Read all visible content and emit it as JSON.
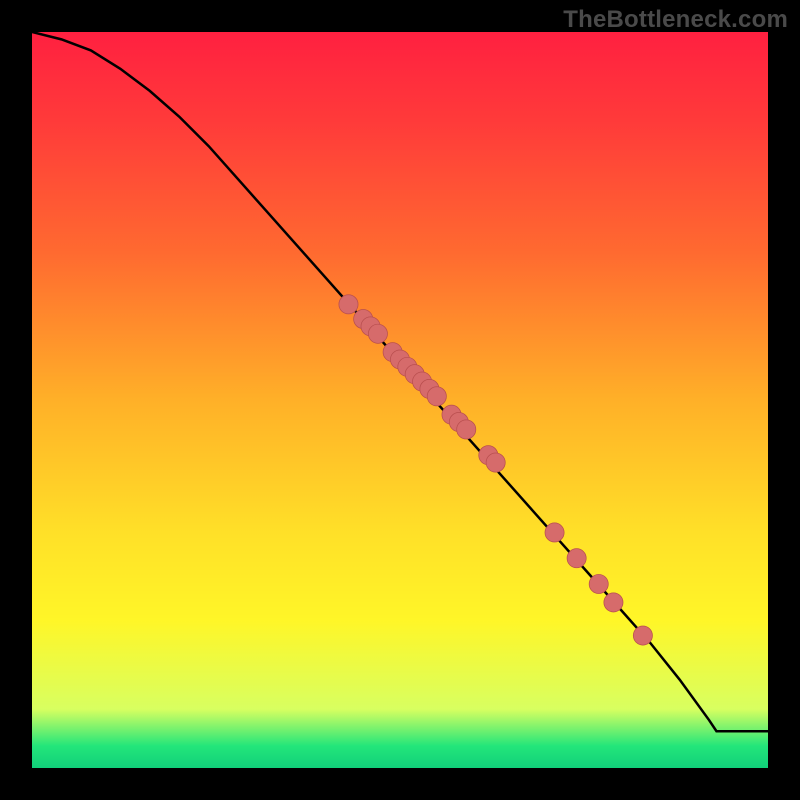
{
  "watermark": "TheBottleneck.com",
  "colors": {
    "curve_stroke": "#000000",
    "dot_fill": "#d66b6b",
    "dot_stroke": "#b84e4e",
    "background_black": "#000000"
  },
  "chart_data": {
    "type": "line",
    "title": "",
    "xlabel": "",
    "ylabel": "",
    "xlim": [
      0,
      100
    ],
    "ylim": [
      0,
      100
    ],
    "grid": false,
    "legend": false,
    "series": [
      {
        "name": "curve",
        "kind": "line",
        "x": [
          0,
          4,
          8,
          12,
          16,
          20,
          24,
          28,
          32,
          36,
          40,
          44,
          48,
          52,
          56,
          60,
          64,
          68,
          72,
          76,
          80,
          84,
          88,
          92,
          93,
          100
        ],
        "y": [
          100,
          99,
          97.5,
          95,
          92,
          88.5,
          84.5,
          80,
          75.5,
          71,
          66.5,
          62,
          57.5,
          53,
          48.5,
          44,
          39.5,
          35,
          30.5,
          26,
          21.5,
          17,
          12,
          6.5,
          5,
          5
        ]
      },
      {
        "name": "highlighted_points",
        "kind": "scatter",
        "x": [
          43,
          45,
          46,
          47,
          49,
          50,
          51,
          52,
          53,
          54,
          55,
          57,
          58,
          59,
          62,
          63,
          71,
          74,
          77,
          79,
          83
        ],
        "y": [
          63,
          61,
          60,
          59,
          56.5,
          55.5,
          54.5,
          53.5,
          52.5,
          51.5,
          50.5,
          48,
          47,
          46,
          42.5,
          41.5,
          32,
          28.5,
          25,
          22.5,
          18
        ]
      }
    ]
  }
}
